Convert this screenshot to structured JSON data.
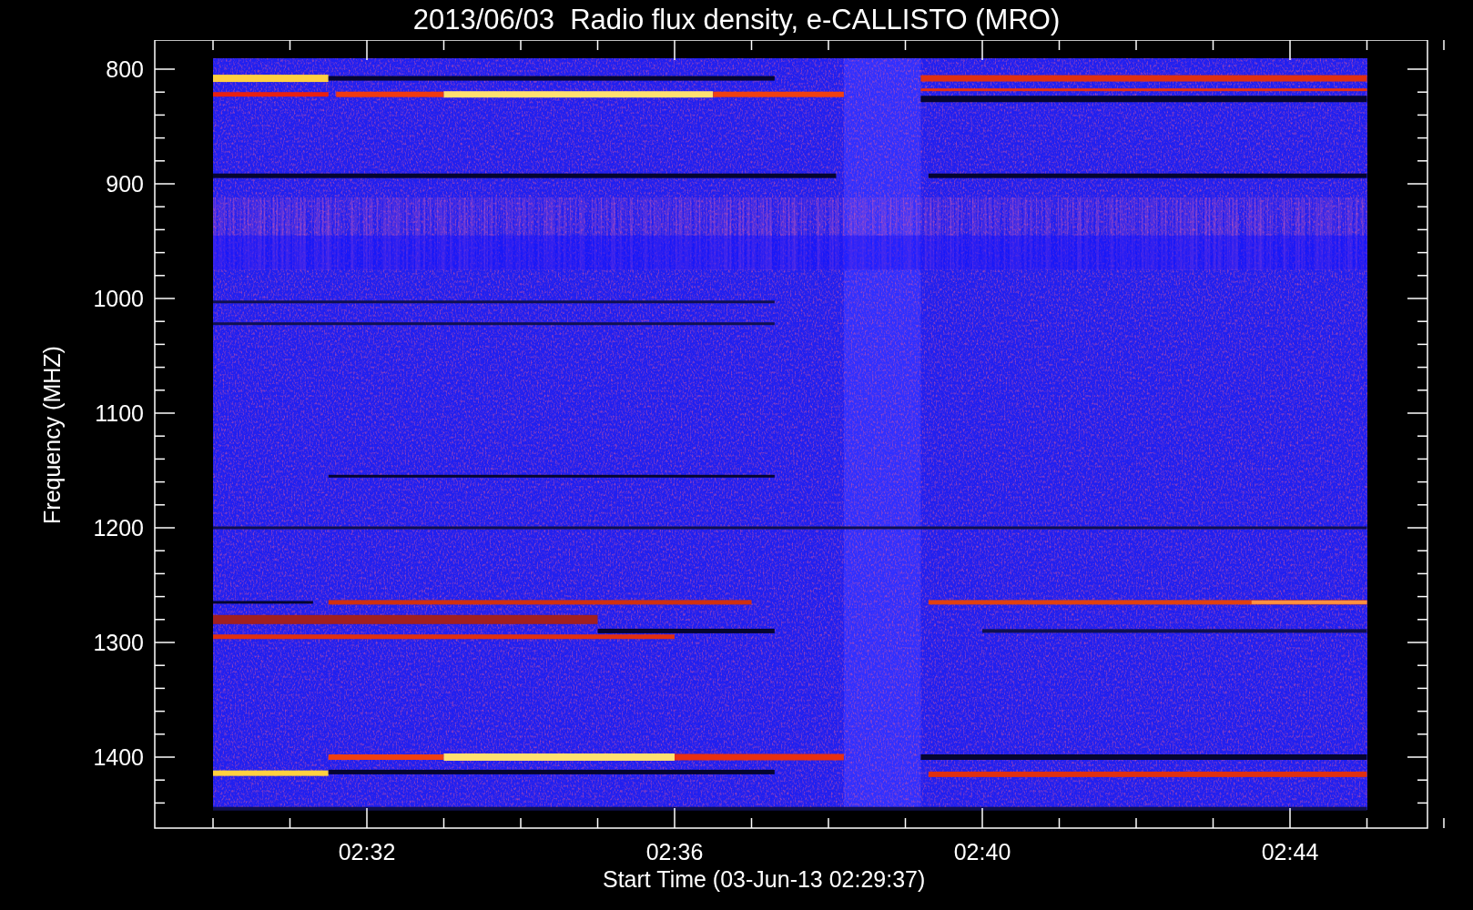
{
  "title": "2013/06/03  Radio flux density, e-CALLISTO (MRO)",
  "y_axis": {
    "label": "Frequency (MHZ)",
    "ticks": [
      "800",
      "900",
      "1000",
      "1100",
      "1200",
      "1300",
      "1400"
    ]
  },
  "x_axis": {
    "label": "Start Time (03-Jun-13 02:29:37)",
    "ticks": [
      "02:32",
      "02:36",
      "02:40",
      "02:44"
    ]
  }
}
